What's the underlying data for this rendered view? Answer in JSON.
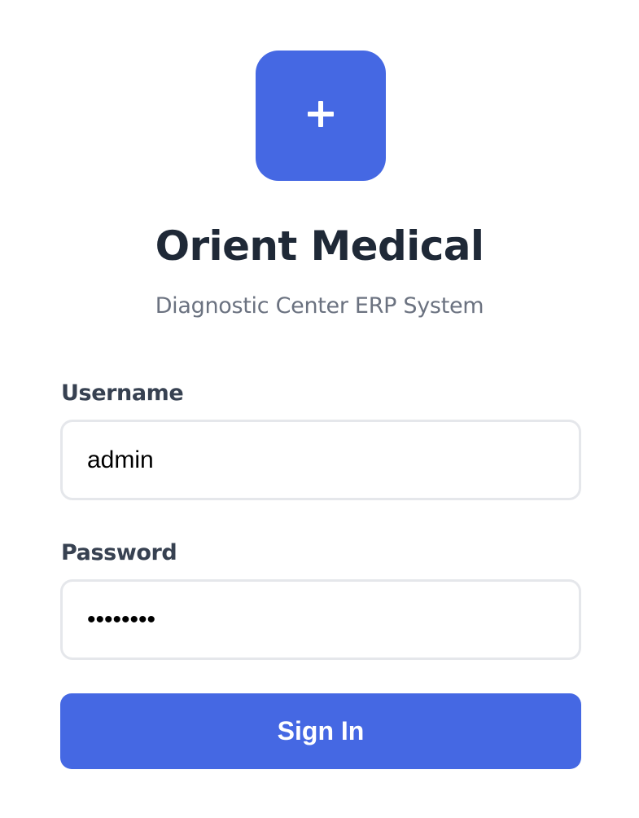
{
  "brand": {
    "logo_icon": "plus-icon",
    "name": "Orient Medical",
    "tagline": "Diagnostic Center ERP System",
    "accent_color": "#4568e3"
  },
  "form": {
    "username": {
      "label": "Username",
      "value": "admin"
    },
    "password": {
      "label": "Password",
      "value": "••••••••"
    },
    "submit_label": "Sign In"
  }
}
